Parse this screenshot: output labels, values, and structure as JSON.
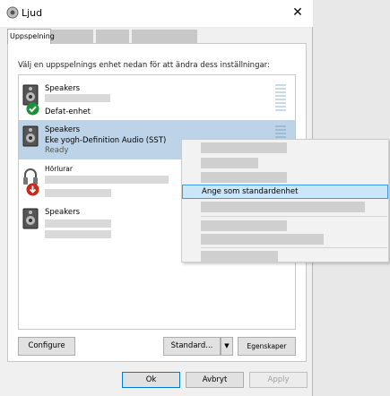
{
  "window": {
    "title": "Ljud",
    "close_symbol": "✕",
    "icon": "speaker-icon"
  },
  "tabs": [
    {
      "label": "Uppspelning",
      "active": true
    },
    {
      "label": "",
      "active": false
    },
    {
      "label": "",
      "active": false
    },
    {
      "label": "",
      "active": false
    }
  ],
  "instruction": "Välj en uppspelnings enhet nedan för att ändra dess inställningar:",
  "devices": [
    {
      "name": "Speakers",
      "line2": "",
      "status": "Defat-enhet",
      "icon": "speaker-icon",
      "badge": "green-check-icon",
      "selected": false
    },
    {
      "name": "Speakers",
      "line2": "Eke yogh-Definition Audio (SST)",
      "status": "Ready",
      "icon": "speaker-icon",
      "selected": true
    },
    {
      "name": "Hörlurar",
      "line2": "",
      "status": "",
      "icon": "headphones-icon",
      "badge": "red-down-arrow-icon",
      "selected": false
    },
    {
      "name": "Speakers",
      "line2": "",
      "status": "",
      "icon": "speaker-icon",
      "selected": false
    }
  ],
  "buttons": {
    "configure": "Configure",
    "set_default": "Standard...",
    "dropdown_arrow": "▼",
    "properties": "Egenskaper",
    "ok": "Ok",
    "cancel": "Avbryt",
    "apply": "Apply"
  },
  "context_menu": {
    "highlighted_item": "Ange som standardenhet"
  },
  "colors": {
    "selection": "#bdd4e8",
    "menu_highlight": "#cce5f7",
    "accent": "#0078d7"
  }
}
